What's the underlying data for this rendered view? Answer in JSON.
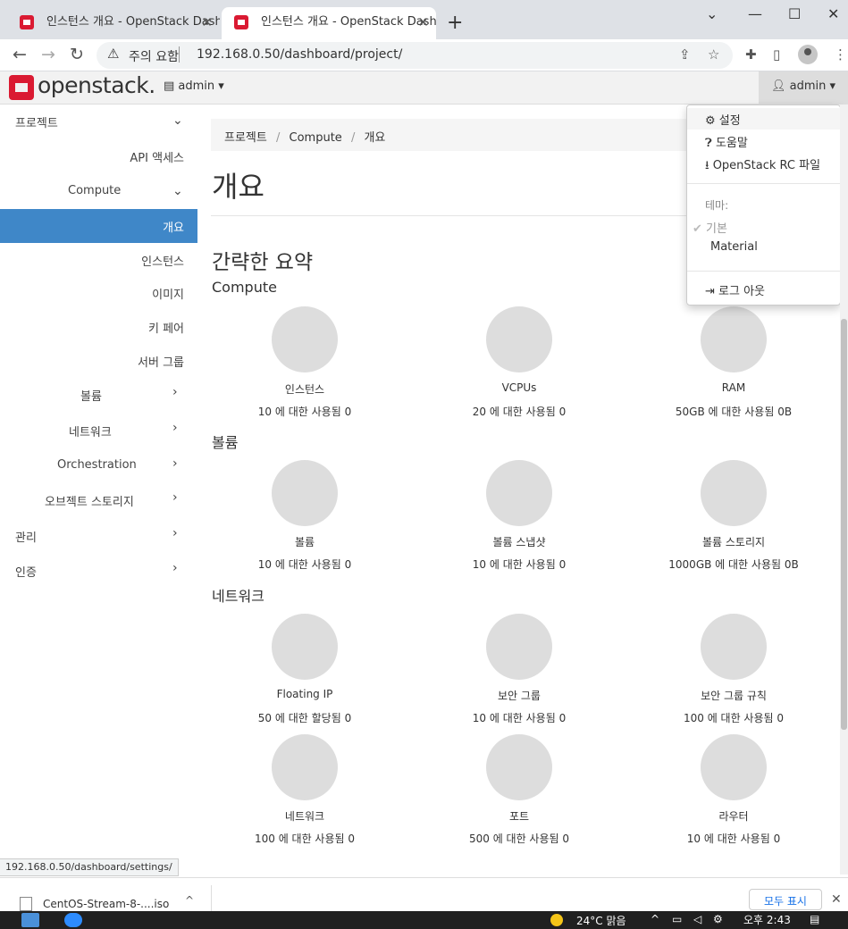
{
  "browser": {
    "tabs": [
      {
        "title": "인스턴스 개요 - OpenStack Dashb",
        "close": "✕"
      },
      {
        "title": "인스턴스 개요 - OpenStack Dashb",
        "close": "✕"
      }
    ],
    "new_tab": "+",
    "window_controls": {
      "minimize": "—",
      "maximize": "☐",
      "close": "✕",
      "chevron": "⌄"
    },
    "nav": {
      "back": "←",
      "forward": "→",
      "reload": "↻"
    },
    "security_warning": "주의 요함",
    "url": "192.168.0.50/dashboard/project/",
    "icons": [
      "share-icon",
      "star-icon",
      "extensions-icon",
      "sidepanel-icon",
      "profile-icon",
      "menu-icon"
    ]
  },
  "header": {
    "logo_text": "openstack.",
    "project_selector": "admin",
    "user_menu": "admin"
  },
  "sidebar": {
    "items": [
      {
        "label": "프로젝트",
        "chevron": "down"
      },
      {
        "label": "API 액세스"
      },
      {
        "label": "Compute",
        "chevron": "down"
      },
      {
        "label": "개요",
        "active": true
      },
      {
        "label": "인스턴스"
      },
      {
        "label": "이미지"
      },
      {
        "label": "키 페어"
      },
      {
        "label": "서버 그룹"
      },
      {
        "label": "볼륨",
        "chevron": "right"
      },
      {
        "label": "네트워크",
        "chevron": "right"
      },
      {
        "label": "Orchestration",
        "chevron": "right"
      },
      {
        "label": "오브젝트 스토리지",
        "chevron": "right"
      },
      {
        "label": "관리",
        "chevron": "right"
      },
      {
        "label": "인증",
        "chevron": "right"
      }
    ],
    "accent_color": "#3f87c8"
  },
  "breadcrumb": [
    "프로젝트",
    "Compute",
    "개요"
  ],
  "breadcrumb_sep": "/",
  "page_title": "개요",
  "summary_title": "간략한 요약",
  "sections": [
    {
      "title": "Compute",
      "charts": [
        {
          "name": "인스턴스",
          "usage": "10 에 대한 사용됨 0",
          "used": 0,
          "total": 10
        },
        {
          "name": "VCPUs",
          "usage": "20 에 대한 사용됨 0",
          "used": 0,
          "total": 20
        },
        {
          "name": "RAM",
          "usage": "50GB 에 대한 사용됨 0B",
          "used": 0,
          "total": 50
        }
      ]
    },
    {
      "title": "볼륨",
      "charts": [
        {
          "name": "볼륨",
          "usage": "10 에 대한 사용됨 0",
          "used": 0,
          "total": 10
        },
        {
          "name": "볼륨 스냅샷",
          "usage": "10 에 대한 사용됨 0",
          "used": 0,
          "total": 10
        },
        {
          "name": "볼륨 스토리지",
          "usage": "1000GB 에 대한 사용됨 0B",
          "used": 0,
          "total": 1000
        }
      ]
    },
    {
      "title": "네트워크",
      "charts": [
        {
          "name": "Floating IP",
          "usage": "50 에 대한 할당됨 0",
          "used": 0,
          "total": 50
        },
        {
          "name": "보안 그룹",
          "usage": "10 에 대한 사용됨 0",
          "used": 0,
          "total": 10
        },
        {
          "name": "보안 그룹 규칙",
          "usage": "100 에 대한 사용됨 0",
          "used": 0,
          "total": 100
        },
        {
          "name": "네트워크",
          "usage": "100 에 대한 사용됨 0",
          "used": 0,
          "total": 100
        },
        {
          "name": "포트",
          "usage": "500 에 대한 사용됨 0",
          "used": 0,
          "total": 500
        },
        {
          "name": "라우터",
          "usage": "10 에 대한 사용됨 0",
          "used": 0,
          "total": 10
        }
      ]
    }
  ],
  "user_dropdown": {
    "items": [
      {
        "label": "설정",
        "icon": "gear-icon"
      },
      {
        "label": "도움말",
        "icon": "help-icon"
      },
      {
        "label": "OpenStack RC 파일",
        "icon": "download-icon"
      }
    ],
    "theme_header": "테마:",
    "themes": [
      {
        "label": "기본",
        "selected": true
      },
      {
        "label": "Material",
        "selected": false
      }
    ],
    "logout": "로그 아웃"
  },
  "status_url": "192.168.0.50/dashboard/settings/",
  "download_bar": {
    "file_name": "CentOS-Stream-8-....iso",
    "show_all": "모두 표시",
    "close": "✕"
  },
  "taskbar": {
    "weather": "24°C 맑음",
    "time": "오후 2:43"
  }
}
